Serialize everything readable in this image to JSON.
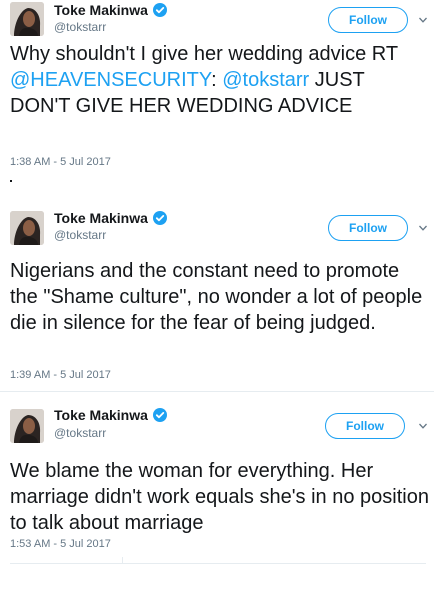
{
  "colors": {
    "accent": "#1da1f2",
    "text": "#14171a",
    "muted": "#657786",
    "divider": "#e6ecf0"
  },
  "tweets": [
    {
      "user": {
        "name": "Toke Makinwa",
        "handle": "@tokstarr",
        "verified": true,
        "avatar_icon": "avatar-photo"
      },
      "follow_label": "Follow",
      "text_parts": {
        "p1": "Why shouldn't I give her wedding advice RT ",
        "m1": "@HEAVENSECURITY",
        "p2": ": ",
        "m2": "@tokstarr",
        "p3": " JUST DON'T GIVE HER WEDDING ADVICE"
      },
      "timestamp": "1:38 AM - 5 Jul 2017"
    },
    {
      "user": {
        "name": "Toke Makinwa",
        "handle": "@tokstarr",
        "verified": true,
        "avatar_icon": "avatar-photo"
      },
      "follow_label": "Follow",
      "text": "Nigerians and the constant need to promote the \"Shame culture\", no wonder a lot of people die in silence for the fear of being judged.",
      "timestamp": "1:39 AM - 5 Jul 2017"
    },
    {
      "user": {
        "name": "Toke Makinwa",
        "handle": "@tokstarr",
        "verified": true,
        "avatar_icon": "avatar-photo"
      },
      "follow_label": "Follow",
      "text": "We blame the woman for everything. Her marriage didn't work equals she's in no position to talk about marriage",
      "timestamp": "1:53 AM - 5 Jul 2017"
    }
  ],
  "separator_mark": "."
}
